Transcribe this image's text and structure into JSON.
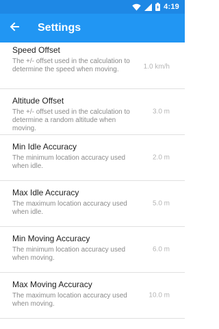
{
  "status_bar": {
    "time": "4:19",
    "icons": [
      "wifi-icon",
      "signal-icon",
      "battery-charging-icon"
    ],
    "color": "#1e88e5"
  },
  "app_bar": {
    "title": "Settings",
    "back_icon": "arrow-left-icon",
    "color": "#2196f3"
  },
  "settings": [
    {
      "title": "Speed Offset",
      "description": "The +/- offset used in the calculation to determine the speed when moving.",
      "value": "1.0 km/h"
    },
    {
      "title": "Altitude Offset",
      "description": "The +/- offset used in the calculation to determine a random altitude when moving.",
      "value": "3.0 m"
    },
    {
      "title": "Min Idle Accuracy",
      "description": "The minimum location accuracy used when idle.",
      "value": "2.0 m"
    },
    {
      "title": "Max Idle Accuracy",
      "description": "The maximum location accuracy used when idle.",
      "value": "5.0 m"
    },
    {
      "title": "Min Moving Accuracy",
      "description": "The minimum location accuracy used when moving.",
      "value": "6.0 m"
    },
    {
      "title": "Max Moving Accuracy",
      "description": "The maximum location accuracy used when moving.",
      "value": "10.0 m"
    }
  ]
}
